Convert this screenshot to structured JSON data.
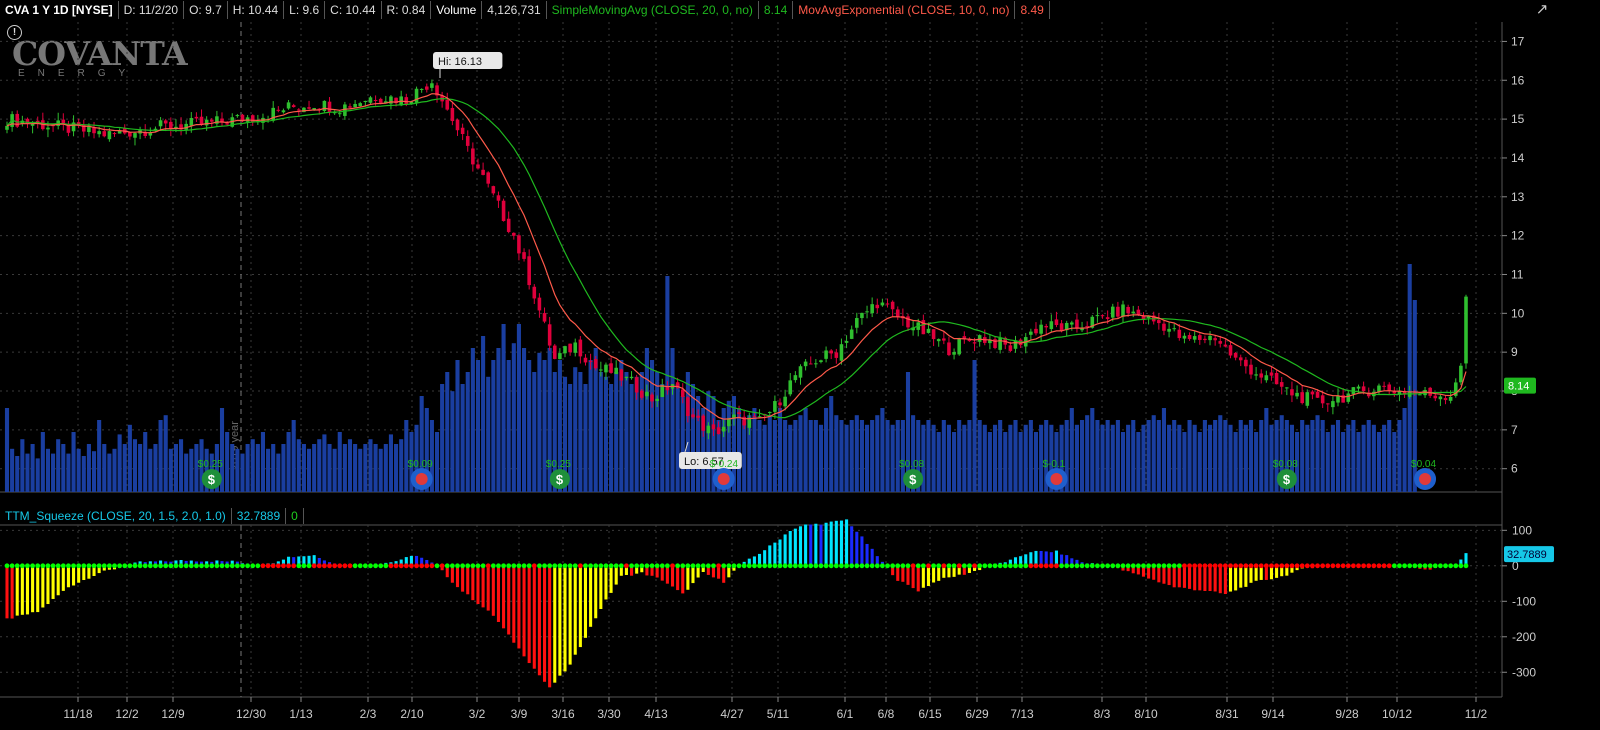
{
  "header": {
    "symbol_label": "CVA 1 Y 1D [NYSE]",
    "date": "D: 11/2/20",
    "open": "O: 9.7",
    "high": "H: 10.44",
    "low": "L: 9.6",
    "close": "C: 10.44",
    "range": "R: 0.84",
    "volume_label": "Volume",
    "volume_value": "4,126,731",
    "sma_label": "SimpleMovingAvg (CLOSE, 20, 0, no)",
    "sma_value": "8.14",
    "ema_label": "MovAvgExponential (CLOSE, 10, 0, no)",
    "ema_value": "8.49"
  },
  "logo": {
    "line1": "COVANTA",
    "line2": "ENERGY"
  },
  "colors": {
    "up": "#2fbf2f",
    "down": "#e0003c",
    "sma": "#1fb81f",
    "ema": "#ff5a4a",
    "volume": "#1a3ea0",
    "squeeze_cyan": "#00e5ff",
    "squeeze_blue": "#1a2aff",
    "squeeze_red": "#ff1010",
    "squeeze_yellow": "#ffff00",
    "dot_green": "#00ff00",
    "dot_red": "#ff0000",
    "grid": "#3a3a3a"
  },
  "chart_data": [
    {
      "type": "candlestick",
      "yticks": [
        "6",
        "7",
        "8",
        "9",
        "10",
        "11",
        "12",
        "13",
        "14",
        "15",
        "16",
        "17"
      ],
      "ylim": [
        5.4,
        17.5
      ],
      "xticks": [
        "11/18",
        "12/2",
        "12/9",
        "12/30",
        "1/13",
        "2/3",
        "2/10",
        "3/2",
        "3/9",
        "3/16",
        "3/30",
        "4/13",
        "4/27",
        "5/11",
        "6/1",
        "6/8",
        "6/15",
        "6/29",
        "7/13",
        "8/3",
        "8/10",
        "8/31",
        "9/14",
        "9/28",
        "10/12",
        "11/2"
      ],
      "year_marker": "2019 year",
      "annotations": {
        "high": "Hi: 16.13",
        "low": "Lo: 6.57"
      },
      "last_price_tag": "8.14",
      "anchors": [
        [
          0,
          15.0
        ],
        [
          10,
          14.8
        ],
        [
          20,
          14.6
        ],
        [
          30,
          14.8
        ],
        [
          40,
          14.9
        ],
        [
          50,
          15.1
        ],
        [
          55,
          15.3
        ],
        [
          60,
          15.4
        ],
        [
          65,
          15.3
        ],
        [
          72,
          15.6
        ],
        [
          78,
          15.5
        ],
        [
          83,
          16.0
        ],
        [
          87,
          15.0
        ],
        [
          90,
          14.2
        ],
        [
          95,
          13.0
        ],
        [
          99,
          12.0
        ],
        [
          103,
          10.5
        ],
        [
          107,
          8.8
        ],
        [
          111,
          9.2
        ],
        [
          115,
          8.6
        ],
        [
          118,
          8.5
        ],
        [
          122,
          8.2
        ],
        [
          126,
          7.8
        ],
        [
          130,
          8.2
        ],
        [
          134,
          7.3
        ],
        [
          138,
          6.9
        ],
        [
          142,
          7.3
        ],
        [
          147,
          7.2
        ],
        [
          150,
          7.6
        ],
        [
          154,
          8.4
        ],
        [
          158,
          8.8
        ],
        [
          162,
          9.0
        ],
        [
          166,
          9.8
        ],
        [
          170,
          10.3
        ],
        [
          174,
          9.9
        ],
        [
          178,
          9.6
        ],
        [
          184,
          9.1
        ],
        [
          190,
          9.4
        ],
        [
          196,
          9.1
        ],
        [
          202,
          9.7
        ],
        [
          208,
          9.6
        ],
        [
          214,
          9.9
        ],
        [
          218,
          10.1
        ],
        [
          222,
          9.9
        ],
        [
          226,
          9.7
        ],
        [
          230,
          9.3
        ],
        [
          236,
          9.4
        ],
        [
          240,
          8.8
        ],
        [
          245,
          8.4
        ],
        [
          250,
          8.0
        ],
        [
          256,
          7.7
        ],
        [
          262,
          7.9
        ],
        [
          268,
          8.1
        ],
        [
          272,
          8.0
        ],
        [
          278,
          7.9
        ],
        [
          282,
          7.9
        ],
        [
          284,
          8.7
        ],
        [
          285,
          10.3
        ]
      ],
      "volume_scale": [
        0.35,
        0.18,
        0.15,
        0.22,
        0.16,
        0.2,
        0.14,
        0.25,
        0.18,
        0.16,
        0.22,
        0.2,
        0.16,
        0.25,
        0.18,
        0.15,
        0.2,
        0.17,
        0.3,
        0.2,
        0.16,
        0.18,
        0.24,
        0.2,
        0.28,
        0.22,
        0.2,
        0.25,
        0.18,
        0.2,
        0.3,
        0.32,
        0.18,
        0.2,
        0.22,
        0.16,
        0.18,
        0.2,
        0.22,
        0.18,
        0.16,
        0.2,
        0.35,
        0.25,
        0.2,
        0.18,
        0.16,
        0.2,
        0.22,
        0.2,
        0.25,
        0.18,
        0.2,
        0.16,
        0.2,
        0.25,
        0.3,
        0.22,
        0.2,
        0.18,
        0.2,
        0.22,
        0.24,
        0.2,
        0.18,
        0.25,
        0.2,
        0.22,
        0.2,
        0.18,
        0.2,
        0.22,
        0.2,
        0.18,
        0.2,
        0.24,
        0.2,
        0.22,
        0.3,
        0.25,
        0.28,
        0.4,
        0.35,
        0.3,
        0.25,
        0.45,
        0.5,
        0.42,
        0.55,
        0.45,
        0.5,
        0.6,
        0.55,
        0.65,
        0.48,
        0.55,
        0.6,
        0.7,
        0.55,
        0.62,
        0.7,
        0.6,
        0.55,
        0.5,
        0.58,
        0.55,
        0.6,
        0.5,
        0.55,
        0.48,
        0.45,
        0.52,
        0.5,
        0.45,
        0.55,
        0.6,
        0.5,
        0.48,
        0.45,
        0.5,
        0.55,
        0.5,
        0.45,
        0.48,
        0.5,
        0.6,
        0.55,
        0.5,
        0.45,
        0.9,
        0.6,
        0.45,
        0.4,
        0.5,
        0.45,
        0.4,
        0.35,
        0.42,
        0.4,
        0.3,
        0.35,
        0.38,
        0.4,
        0.35,
        0.3,
        0.32,
        0.35,
        0.3,
        0.28,
        0.32,
        0.3,
        0.35,
        0.3,
        0.28,
        0.3,
        0.32,
        0.35,
        0.3,
        0.3,
        0.28,
        0.35,
        0.4,
        0.32,
        0.3,
        0.28,
        0.3,
        0.32,
        0.3,
        0.28,
        0.3,
        0.32,
        0.35,
        0.3,
        0.28,
        0.3,
        0.3,
        0.5,
        0.32,
        0.3,
        0.28,
        0.3,
        0.28,
        0.25,
        0.3,
        0.28,
        0.25,
        0.3,
        0.28,
        0.3,
        0.55,
        0.3,
        0.28,
        0.25,
        0.28,
        0.3,
        0.25,
        0.28,
        0.3,
        0.25,
        0.28,
        0.3,
        0.25,
        0.28,
        0.3,
        0.28,
        0.25,
        0.28,
        0.3,
        0.35,
        0.28,
        0.3,
        0.32,
        0.35,
        0.3,
        0.28,
        0.3,
        0.28,
        0.3,
        0.25,
        0.28,
        0.3,
        0.25,
        0.28,
        0.3,
        0.32,
        0.3,
        0.35,
        0.28,
        0.3,
        0.28,
        0.25,
        0.3,
        0.28,
        0.25,
        0.3,
        0.28,
        0.3,
        0.32,
        0.3,
        0.28,
        0.25,
        0.3,
        0.28,
        0.3,
        0.25,
        0.3,
        0.35,
        0.28,
        0.3,
        0.32,
        0.3,
        0.28,
        0.25,
        0.3,
        0.28,
        0.3,
        0.32,
        0.3,
        0.25,
        0.28,
        0.3,
        0.25,
        0.28,
        0.3,
        0.25,
        0.28,
        0.3,
        0.28,
        0.25,
        0.28,
        0.3,
        0.25,
        0.3,
        0.35,
        0.95,
        0.8
      ],
      "events": [
        {
          "idx": 40,
          "kind": "dividend",
          "label": "$0.25"
        },
        {
          "idx": 81,
          "kind": "earnings",
          "label": "$0.09"
        },
        {
          "idx": 108,
          "kind": "dividend",
          "label": "$0.25"
        },
        {
          "idx": 140,
          "kind": "earnings",
          "label": "$-0.24"
        },
        {
          "idx": 177,
          "kind": "dividend",
          "label": "$0.08"
        },
        {
          "idx": 205,
          "kind": "earnings",
          "label": "$-0.1"
        },
        {
          "idx": 250,
          "kind": "dividend",
          "label": "$0.08"
        },
        {
          "idx": 277,
          "kind": "earnings",
          "label": "$0.04"
        }
      ]
    },
    {
      "type": "histogram",
      "title": "TTM_Squeeze (CLOSE, 20, 1.5, 2.0, 1.0)",
      "value_label": "32.7889",
      "squeeze_label": "0",
      "yticks": [
        "100",
        "0",
        "-100",
        "-200",
        "-300"
      ],
      "ylim": [
        -350,
        115
      ],
      "last_value_tag": "32.7889",
      "anchors": [
        [
          0,
          -150
        ],
        [
          6,
          -130
        ],
        [
          12,
          -60
        ],
        [
          18,
          -20
        ],
        [
          22,
          -5
        ],
        [
          26,
          10
        ],
        [
          35,
          15
        ],
        [
          45,
          12
        ],
        [
          50,
          0
        ],
        [
          55,
          25
        ],
        [
          60,
          30
        ],
        [
          65,
          0
        ],
        [
          75,
          10
        ],
        [
          80,
          30
        ],
        [
          84,
          0
        ],
        [
          88,
          -60
        ],
        [
          95,
          -140
        ],
        [
          103,
          -290
        ],
        [
          106,
          -345
        ],
        [
          110,
          -280
        ],
        [
          116,
          -120
        ],
        [
          120,
          -30
        ],
        [
          124,
          -20
        ],
        [
          128,
          -40
        ],
        [
          132,
          -80
        ],
        [
          136,
          -20
        ],
        [
          140,
          -45
        ],
        [
          143,
          0
        ],
        [
          147,
          35
        ],
        [
          150,
          65
        ],
        [
          153,
          100
        ],
        [
          156,
          115
        ],
        [
          160,
          120
        ],
        [
          164,
          130
        ],
        [
          167,
          80
        ],
        [
          171,
          10
        ],
        [
          174,
          -40
        ],
        [
          178,
          -70
        ],
        [
          182,
          -40
        ],
        [
          188,
          -20
        ],
        [
          192,
          0
        ],
        [
          196,
          15
        ],
        [
          200,
          40
        ],
        [
          205,
          40
        ],
        [
          210,
          10
        ],
        [
          215,
          0
        ],
        [
          222,
          -30
        ],
        [
          228,
          -60
        ],
        [
          234,
          -70
        ],
        [
          238,
          -80
        ],
        [
          244,
          -45
        ],
        [
          249,
          -30
        ],
        [
          254,
          -5
        ],
        [
          258,
          0
        ],
        [
          264,
          5
        ],
        [
          270,
          0
        ],
        [
          278,
          -10
        ],
        [
          283,
          5
        ],
        [
          285,
          32.7889
        ]
      ]
    }
  ]
}
